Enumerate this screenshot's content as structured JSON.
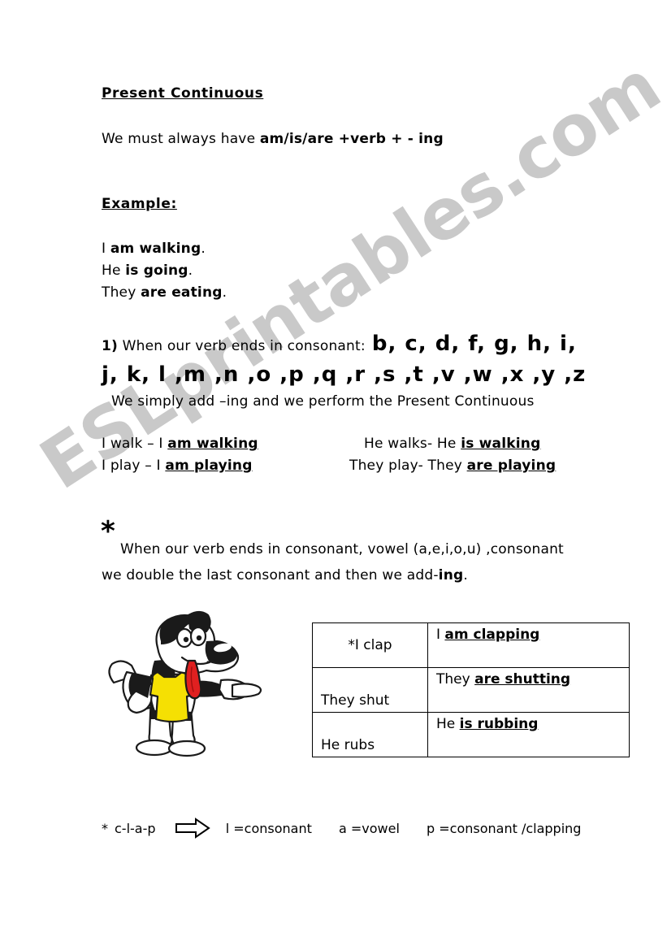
{
  "document": {
    "title": "Present Continuous",
    "watermark": "ESLprintables.com",
    "watermark_color": "#c9c9c9"
  },
  "rule": {
    "lead": "We must always have ",
    "formula": "am/is/are  +verb  +  - ing"
  },
  "example_heading": "Example:",
  "examples": [
    {
      "subject": "I ",
      "verb": "am walking",
      "end": "."
    },
    {
      "subject": "He ",
      "verb": "is going",
      "end": "."
    },
    {
      "subject": "They ",
      "verb": "are eating",
      "end": "."
    }
  ],
  "rule_one": {
    "number": "1)",
    "text": " When our verb ends in consonant:",
    "letters_line_1": "b,  c,  d,  f,  g,  h,  i,",
    "letters_line_2": "j,  k,  l ,m ,n ,o ,p ,q ,r ,s ,t ,v ,w ,x ,y ,z",
    "note": "We simply add –ing and we perform the Present Continuous"
  },
  "conjugation_examples": {
    "left": [
      {
        "base": "I walk – I ",
        "form": "am  walking"
      },
      {
        "base": "I play – I ",
        "form": "am playing"
      }
    ],
    "right": [
      {
        "base": "He walks- He ",
        "form": "is walking"
      },
      {
        "base": "They play- They ",
        "form": "are playing"
      }
    ]
  },
  "rule_two": {
    "bullet": "*",
    "line_1": "When our verb ends in consonant, vowel (a,e,i,o,u) ,consonant",
    "line_2_pre": "we double the last consonant and then we add-",
    "line_2_bold": "ing",
    "line_2_end": "."
  },
  "table": {
    "rows": [
      {
        "base": "*I clap",
        "answer_pre": "I ",
        "answer_bold": "am clapping"
      },
      {
        "base": "They shut",
        "answer_pre": "They ",
        "answer_bold": "are shutting"
      },
      {
        "base": "He rubs",
        "answer_pre": "He ",
        "answer_bold": "is rubbing"
      }
    ]
  },
  "footer": {
    "bullet": "*",
    "word": "c-l-a-p",
    "arrow": "right-arrow-icon",
    "parts": [
      "l =consonant",
      "a =vowel",
      "p =consonant  /clapping"
    ]
  },
  "clipart": {
    "name": "cartoon-dog-pointing",
    "shirt_color": "#f5e003",
    "tongue_color": "#e02020",
    "outline_color": "#1a1a1a"
  }
}
